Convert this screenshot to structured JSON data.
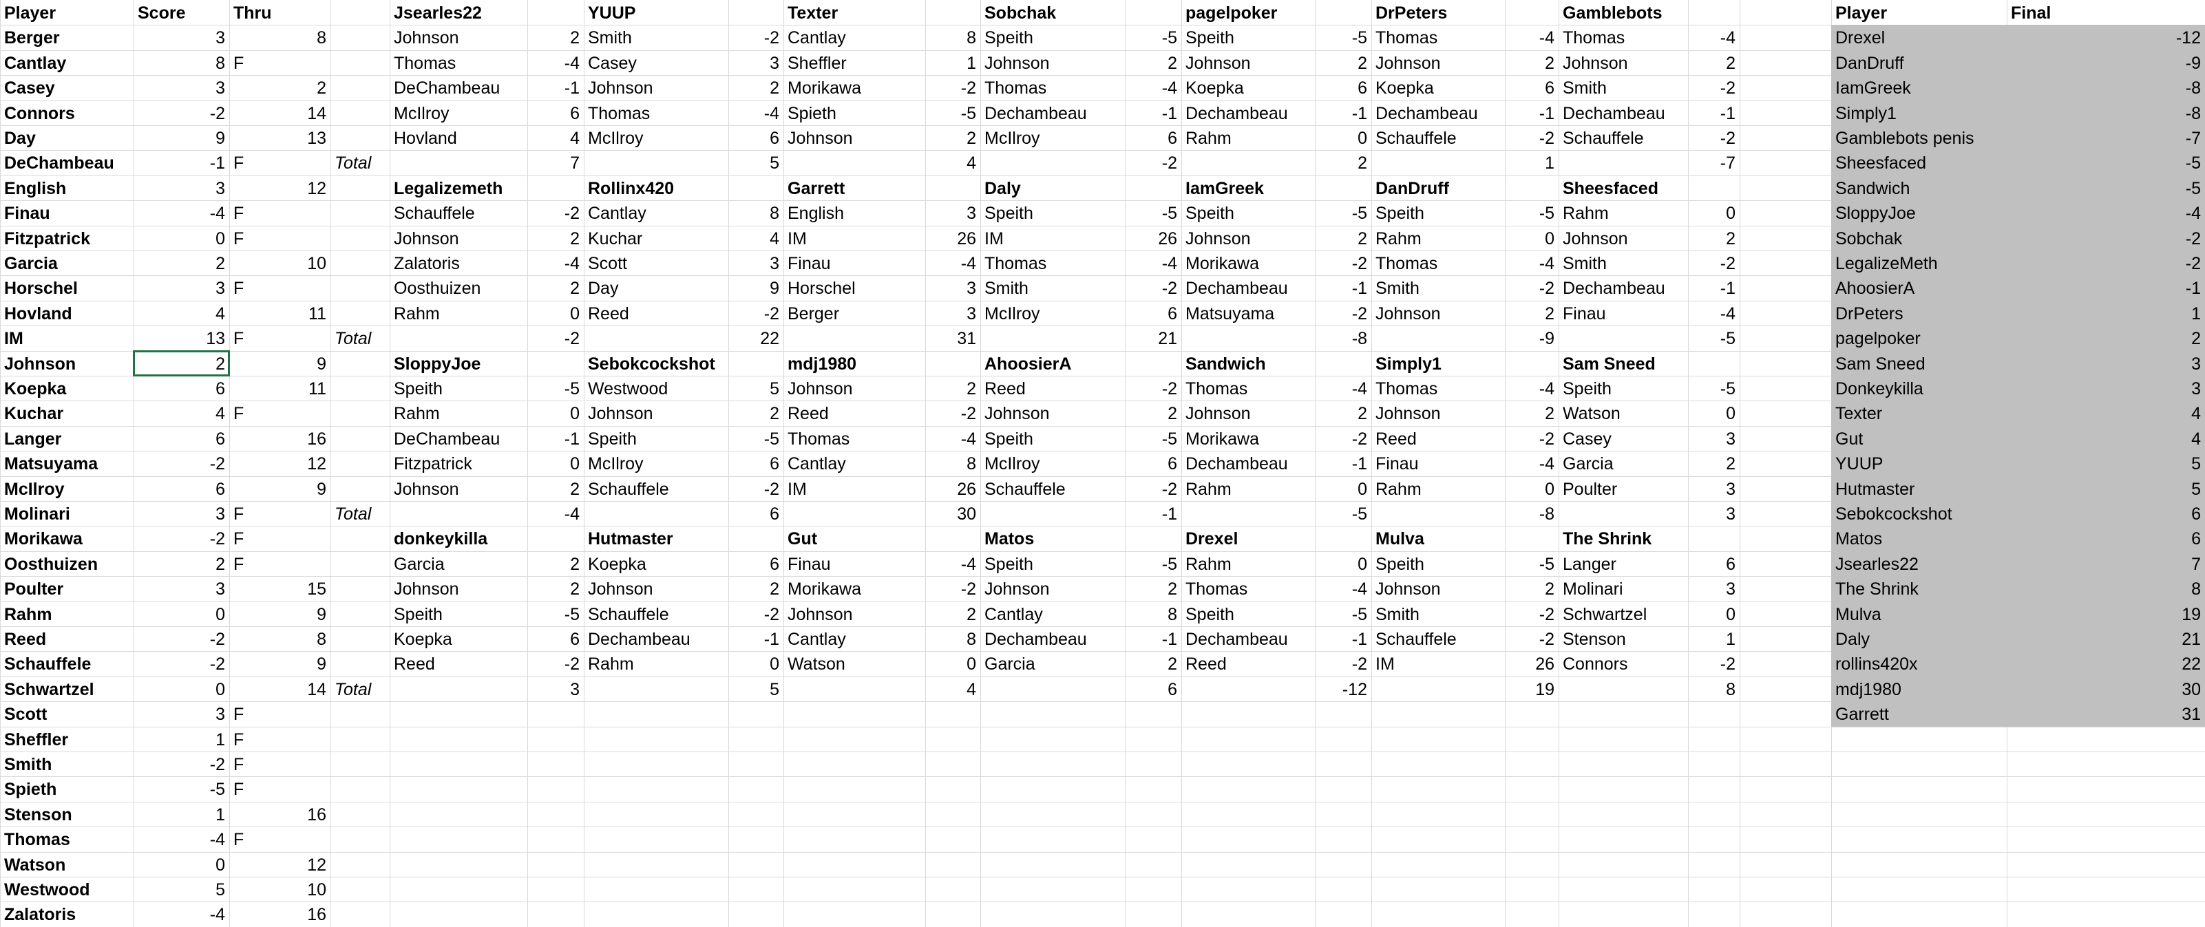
{
  "colors": {
    "gridline": "#d9d9d9",
    "selection": "#217346",
    "standings_fill": "#c0c0c0"
  },
  "leaderboard": {
    "headers": [
      "Player",
      "Score",
      "Thru"
    ],
    "rows": [
      [
        "Berger",
        "3",
        "8"
      ],
      [
        "Cantlay",
        "8",
        "F"
      ],
      [
        "Casey",
        "3",
        "2"
      ],
      [
        "Connors",
        "-2",
        "14"
      ],
      [
        "Day",
        "9",
        "13"
      ],
      [
        "DeChambeau",
        "-1",
        "F"
      ],
      [
        "English",
        "3",
        "12"
      ],
      [
        "Finau",
        "-4",
        "F"
      ],
      [
        "Fitzpatrick",
        "0",
        "F"
      ],
      [
        "Garcia",
        "2",
        "10"
      ],
      [
        "Horschel",
        "3",
        "F"
      ],
      [
        "Hovland",
        "4",
        "11"
      ],
      [
        "IM",
        "13",
        "F"
      ],
      [
        "Johnson",
        "2",
        "9"
      ],
      [
        "Koepka",
        "6",
        "11"
      ],
      [
        "Kuchar",
        "4",
        "F"
      ],
      [
        "Langer",
        "6",
        "16"
      ],
      [
        "Matsuyama",
        "-2",
        "12"
      ],
      [
        "McIlroy",
        "6",
        "9"
      ],
      [
        "Molinari",
        "3",
        "F"
      ],
      [
        "Morikawa",
        "-2",
        "F"
      ],
      [
        "Oosthuizen",
        "2",
        "F"
      ],
      [
        "Poulter",
        "3",
        "15"
      ],
      [
        "Rahm",
        "0",
        "9"
      ],
      [
        "Reed",
        "-2",
        "8"
      ],
      [
        "Schauffele",
        "-2",
        "9"
      ],
      [
        "Schwartzel",
        "0",
        "14"
      ],
      [
        "Scott",
        "3",
        "F"
      ],
      [
        "Sheffler",
        "1",
        "F"
      ],
      [
        "Smith",
        "-2",
        "F"
      ],
      [
        "Spieth",
        "-5",
        "F"
      ],
      [
        "Stenson",
        "1",
        "16"
      ],
      [
        "Thomas",
        "-4",
        "F"
      ],
      [
        "Watson",
        "0",
        "12"
      ],
      [
        "Westwood",
        "5",
        "10"
      ],
      [
        "Zalatoris",
        "-4",
        "16"
      ]
    ]
  },
  "total_label": "Total",
  "teams": [
    {
      "name": "Jsearles22",
      "picks": [
        [
          "Johnson",
          "2"
        ],
        [
          "Thomas",
          "-4"
        ],
        [
          "DeChambeau",
          "-1"
        ],
        [
          "McIlroy",
          "6"
        ],
        [
          "Hovland",
          "4"
        ]
      ],
      "total": "7"
    },
    {
      "name": "YUUP",
      "picks": [
        [
          "Smith",
          "-2"
        ],
        [
          "Casey",
          "3"
        ],
        [
          "Johnson",
          "2"
        ],
        [
          "Thomas",
          "-4"
        ],
        [
          "McIlroy",
          "6"
        ]
      ],
      "total": "5"
    },
    {
      "name": "Texter",
      "picks": [
        [
          "Cantlay",
          "8"
        ],
        [
          "Sheffler",
          "1"
        ],
        [
          "Morikawa",
          "-2"
        ],
        [
          "Spieth",
          "-5"
        ],
        [
          "Johnson",
          "2"
        ]
      ],
      "total": "4"
    },
    {
      "name": "Sobchak",
      "picks": [
        [
          "Speith",
          "-5"
        ],
        [
          "Johnson",
          "2"
        ],
        [
          "Thomas",
          "-4"
        ],
        [
          "Dechambeau",
          "-1"
        ],
        [
          "McIlroy",
          "6"
        ]
      ],
      "total": "-2"
    },
    {
      "name": "pagelpoker",
      "picks": [
        [
          "Speith",
          "-5"
        ],
        [
          "Johnson",
          "2"
        ],
        [
          "Koepka",
          "6"
        ],
        [
          "Dechambeau",
          "-1"
        ],
        [
          "Rahm",
          "0"
        ]
      ],
      "total": "2"
    },
    {
      "name": "DrPeters",
      "picks": [
        [
          "Thomas",
          "-4"
        ],
        [
          "Johnson",
          "2"
        ],
        [
          "Koepka",
          "6"
        ],
        [
          "Dechambeau",
          "-1"
        ],
        [
          "Schauffele",
          "-2"
        ]
      ],
      "total": "1"
    },
    {
      "name": "Gamblebots",
      "picks": [
        [
          "Thomas",
          "-4"
        ],
        [
          "Johnson",
          "2"
        ],
        [
          "Smith",
          "-2"
        ],
        [
          "Dechambeau",
          "-1"
        ],
        [
          "Schauffele",
          "-2"
        ]
      ],
      "total": "-7"
    },
    {
      "name": "Legalizemeth",
      "picks": [
        [
          "Schauffele",
          "-2"
        ],
        [
          "Johnson",
          "2"
        ],
        [
          "Zalatoris",
          "-4"
        ],
        [
          "Oosthuizen",
          "2"
        ],
        [
          "Rahm",
          "0"
        ]
      ],
      "total": "-2"
    },
    {
      "name": "Rollinx420",
      "picks": [
        [
          "Cantlay",
          "8"
        ],
        [
          "Kuchar",
          "4"
        ],
        [
          "Scott",
          "3"
        ],
        [
          "Day",
          "9"
        ],
        [
          "Reed",
          "-2"
        ]
      ],
      "total": "22"
    },
    {
      "name": "Garrett",
      "picks": [
        [
          "English",
          "3"
        ],
        [
          "IM",
          "26"
        ],
        [
          "Finau",
          "-4"
        ],
        [
          "Horschel",
          "3"
        ],
        [
          "Berger",
          "3"
        ]
      ],
      "total": "31"
    },
    {
      "name": "Daly",
      "picks": [
        [
          "Speith",
          "-5"
        ],
        [
          "IM",
          "26"
        ],
        [
          "Thomas",
          "-4"
        ],
        [
          "Smith",
          "-2"
        ],
        [
          "McIlroy",
          "6"
        ]
      ],
      "total": "21"
    },
    {
      "name": "IamGreek",
      "picks": [
        [
          "Speith",
          "-5"
        ],
        [
          "Johnson",
          "2"
        ],
        [
          "Morikawa",
          "-2"
        ],
        [
          "Dechambeau",
          "-1"
        ],
        [
          "Matsuyama",
          "-2"
        ]
      ],
      "total": "-8"
    },
    {
      "name": "DanDruff",
      "picks": [
        [
          "Speith",
          "-5"
        ],
        [
          "Rahm",
          "0"
        ],
        [
          "Thomas",
          "-4"
        ],
        [
          "Smith",
          "-2"
        ],
        [
          "Johnson",
          "2"
        ]
      ],
      "total": "-9"
    },
    {
      "name": "Sheesfaced",
      "picks": [
        [
          "Rahm",
          "0"
        ],
        [
          "Johnson",
          "2"
        ],
        [
          "Smith",
          "-2"
        ],
        [
          "Dechambeau",
          "-1"
        ],
        [
          "Finau",
          "-4"
        ]
      ],
      "total": "-5"
    },
    {
      "name": "SloppyJoe",
      "picks": [
        [
          "Speith",
          "-5"
        ],
        [
          "Rahm",
          "0"
        ],
        [
          "DeChambeau",
          "-1"
        ],
        [
          "Fitzpatrick",
          "0"
        ],
        [
          "Johnson",
          "2"
        ]
      ],
      "total": "-4"
    },
    {
      "name": "Sebokcockshot",
      "picks": [
        [
          "Westwood",
          "5"
        ],
        [
          "Johnson",
          "2"
        ],
        [
          "Speith",
          "-5"
        ],
        [
          "McIlroy",
          "6"
        ],
        [
          "Schauffele",
          "-2"
        ]
      ],
      "total": "6"
    },
    {
      "name": "mdj1980",
      "picks": [
        [
          "Johnson",
          "2"
        ],
        [
          "Reed",
          "-2"
        ],
        [
          "Thomas",
          "-4"
        ],
        [
          "Cantlay",
          "8"
        ],
        [
          "IM",
          "26"
        ]
      ],
      "total": "30"
    },
    {
      "name": "AhoosierA",
      "picks": [
        [
          "Reed",
          "-2"
        ],
        [
          "Johnson",
          "2"
        ],
        [
          "Speith",
          "-5"
        ],
        [
          "McIlroy",
          "6"
        ],
        [
          "Schauffele",
          "-2"
        ]
      ],
      "total": "-1"
    },
    {
      "name": "Sandwich",
      "picks": [
        [
          "Thomas",
          "-4"
        ],
        [
          "Johnson",
          "2"
        ],
        [
          "Morikawa",
          "-2"
        ],
        [
          "Dechambeau",
          "-1"
        ],
        [
          "Rahm",
          "0"
        ]
      ],
      "total": "-5"
    },
    {
      "name": "Simply1",
      "picks": [
        [
          "Thomas",
          "-4"
        ],
        [
          "Johnson",
          "2"
        ],
        [
          "Reed",
          "-2"
        ],
        [
          "Finau",
          "-4"
        ],
        [
          "Rahm",
          "0"
        ]
      ],
      "total": "-8"
    },
    {
      "name": "Sam Sneed",
      "picks": [
        [
          "Speith",
          "-5"
        ],
        [
          "Watson",
          "0"
        ],
        [
          "Casey",
          "3"
        ],
        [
          "Garcia",
          "2"
        ],
        [
          "Poulter",
          "3"
        ]
      ],
      "total": "3"
    },
    {
      "name": "donkeykilla",
      "picks": [
        [
          "Garcia",
          "2"
        ],
        [
          "Johnson",
          "2"
        ],
        [
          "Speith",
          "-5"
        ],
        [
          "Koepka",
          "6"
        ],
        [
          "Reed",
          "-2"
        ]
      ],
      "total": "3"
    },
    {
      "name": "Hutmaster",
      "picks": [
        [
          "Koepka",
          "6"
        ],
        [
          "Johnson",
          "2"
        ],
        [
          "Schauffele",
          "-2"
        ],
        [
          "Dechambeau",
          "-1"
        ],
        [
          "Rahm",
          "0"
        ]
      ],
      "total": "5"
    },
    {
      "name": "Gut",
      "picks": [
        [
          "Finau",
          "-4"
        ],
        [
          "Morikawa",
          "-2"
        ],
        [
          "Johnson",
          "2"
        ],
        [
          "Cantlay",
          "8"
        ],
        [
          "Watson",
          "0"
        ]
      ],
      "total": "4"
    },
    {
      "name": "Matos",
      "picks": [
        [
          "Speith",
          "-5"
        ],
        [
          "Johnson",
          "2"
        ],
        [
          "Cantlay",
          "8"
        ],
        [
          "Dechambeau",
          "-1"
        ],
        [
          "Garcia",
          "2"
        ]
      ],
      "total": "6"
    },
    {
      "name": "Drexel",
      "picks": [
        [
          "Rahm",
          "0"
        ],
        [
          "Thomas",
          "-4"
        ],
        [
          "Speith",
          "-5"
        ],
        [
          "Dechambeau",
          "-1"
        ],
        [
          "Reed",
          "-2"
        ]
      ],
      "total": "-12"
    },
    {
      "name": "Mulva",
      "picks": [
        [
          "Speith",
          "-5"
        ],
        [
          "Johnson",
          "2"
        ],
        [
          "Smith",
          "-2"
        ],
        [
          "Schauffele",
          "-2"
        ],
        [
          "IM",
          "26"
        ]
      ],
      "total": "19"
    },
    {
      "name": "The Shrink",
      "picks": [
        [
          "Langer",
          "6"
        ],
        [
          "Molinari",
          "3"
        ],
        [
          "Schwartzel",
          "0"
        ],
        [
          "Stenson",
          "1"
        ],
        [
          "Connors",
          "-2"
        ]
      ],
      "total": "8"
    }
  ],
  "standings": {
    "headers": [
      "Player",
      "Final"
    ],
    "rows": [
      [
        "Drexel",
        "-12"
      ],
      [
        "DanDruff",
        "-9"
      ],
      [
        "IamGreek",
        "-8"
      ],
      [
        "Simply1",
        "-8"
      ],
      [
        "Gamblebots penis",
        "-7"
      ],
      [
        "Sheesfaced",
        "-5"
      ],
      [
        "Sandwich",
        "-5"
      ],
      [
        "SloppyJoe",
        "-4"
      ],
      [
        "Sobchak",
        "-2"
      ],
      [
        "LegalizeMeth",
        "-2"
      ],
      [
        "AhoosierA",
        "-1"
      ],
      [
        "DrPeters",
        "1"
      ],
      [
        "pagelpoker",
        "2"
      ],
      [
        "Sam Sneed",
        "3"
      ],
      [
        "Donkeykilla",
        "3"
      ],
      [
        "Texter",
        "4"
      ],
      [
        "Gut",
        "4"
      ],
      [
        "YUUP",
        "5"
      ],
      [
        "Hutmaster",
        "5"
      ],
      [
        "Sebokcockshot",
        "6"
      ],
      [
        "Matos",
        "6"
      ],
      [
        "Jsearles22",
        "7"
      ],
      [
        "The Shrink",
        "8"
      ],
      [
        "Mulva",
        "19"
      ],
      [
        "Daly",
        "21"
      ],
      [
        "rollins420x",
        "22"
      ],
      [
        "mdj1980",
        "30"
      ],
      [
        "Garrett",
        "31"
      ]
    ]
  }
}
